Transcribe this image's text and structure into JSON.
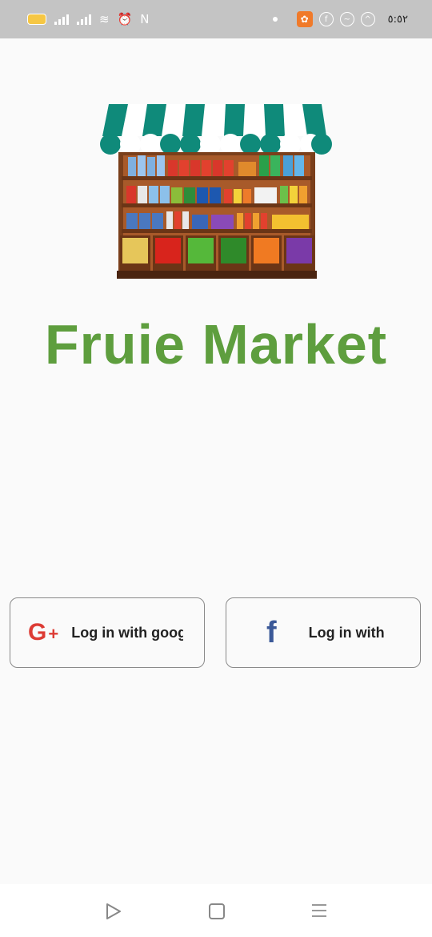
{
  "status_bar": {
    "time": "٥:٥٢",
    "icons": [
      "battery-icon",
      "signal-icon",
      "signal-icon",
      "wifi-icon",
      "alarm-icon",
      "nfc-icon",
      "notification-dot",
      "app-icon",
      "facebook-icon",
      "messenger-icon",
      "app-circle-icon"
    ]
  },
  "app": {
    "title": "Fruie Market",
    "title_color": "#5e9e3e"
  },
  "buttons": {
    "google_label": "Log in with googl",
    "google_icon": "G+",
    "facebook_label": "Log in with",
    "facebook_icon": "f"
  },
  "nav": {
    "icons": [
      "back-triangle-icon",
      "home-square-icon",
      "menu-lines-icon"
    ]
  },
  "colors": {
    "google_red": "#dd3b34",
    "facebook_blue": "#3b5998",
    "awning_green": "#0f8a7a"
  }
}
